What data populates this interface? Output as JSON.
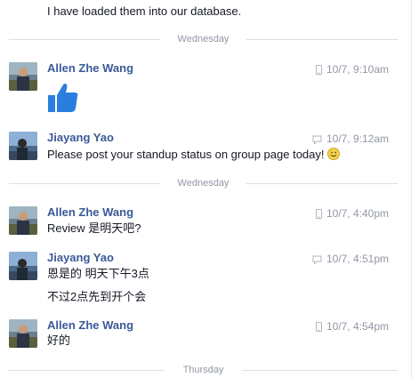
{
  "top_message": "I have loaded them into our database.",
  "dividers": [
    "Wednesday",
    "Wednesday",
    "Thursday"
  ],
  "colors": {
    "name": "#3b5998",
    "meta": "#9197a3",
    "like": "#2a7ee0"
  },
  "messages": [
    {
      "sender": "Allen Zhe Wang",
      "time": "10/7, 9:10am",
      "device_icon": "phone-icon",
      "body": "thumbs-up sticker"
    },
    {
      "sender": "Jiayang Yao",
      "time": "10/7, 9:12am",
      "device_icon": "chat-bubble-icon",
      "text": "Please post your standup status on group page today!",
      "emoji": "smiley-emoji-icon"
    },
    {
      "sender": "Allen Zhe Wang",
      "time": "10/7, 4:40pm",
      "device_icon": "phone-icon",
      "text": "Review 是明天吧?"
    },
    {
      "sender": "Jiayang Yao",
      "time": "10/7, 4:51pm",
      "device_icon": "chat-bubble-icon",
      "text": "恩是的 明天下午3点",
      "text2": "不过2点先到开个会"
    },
    {
      "sender": "Allen Zhe Wang",
      "time": "10/7, 4:54pm",
      "device_icon": "phone-icon",
      "text": "好的"
    }
  ]
}
